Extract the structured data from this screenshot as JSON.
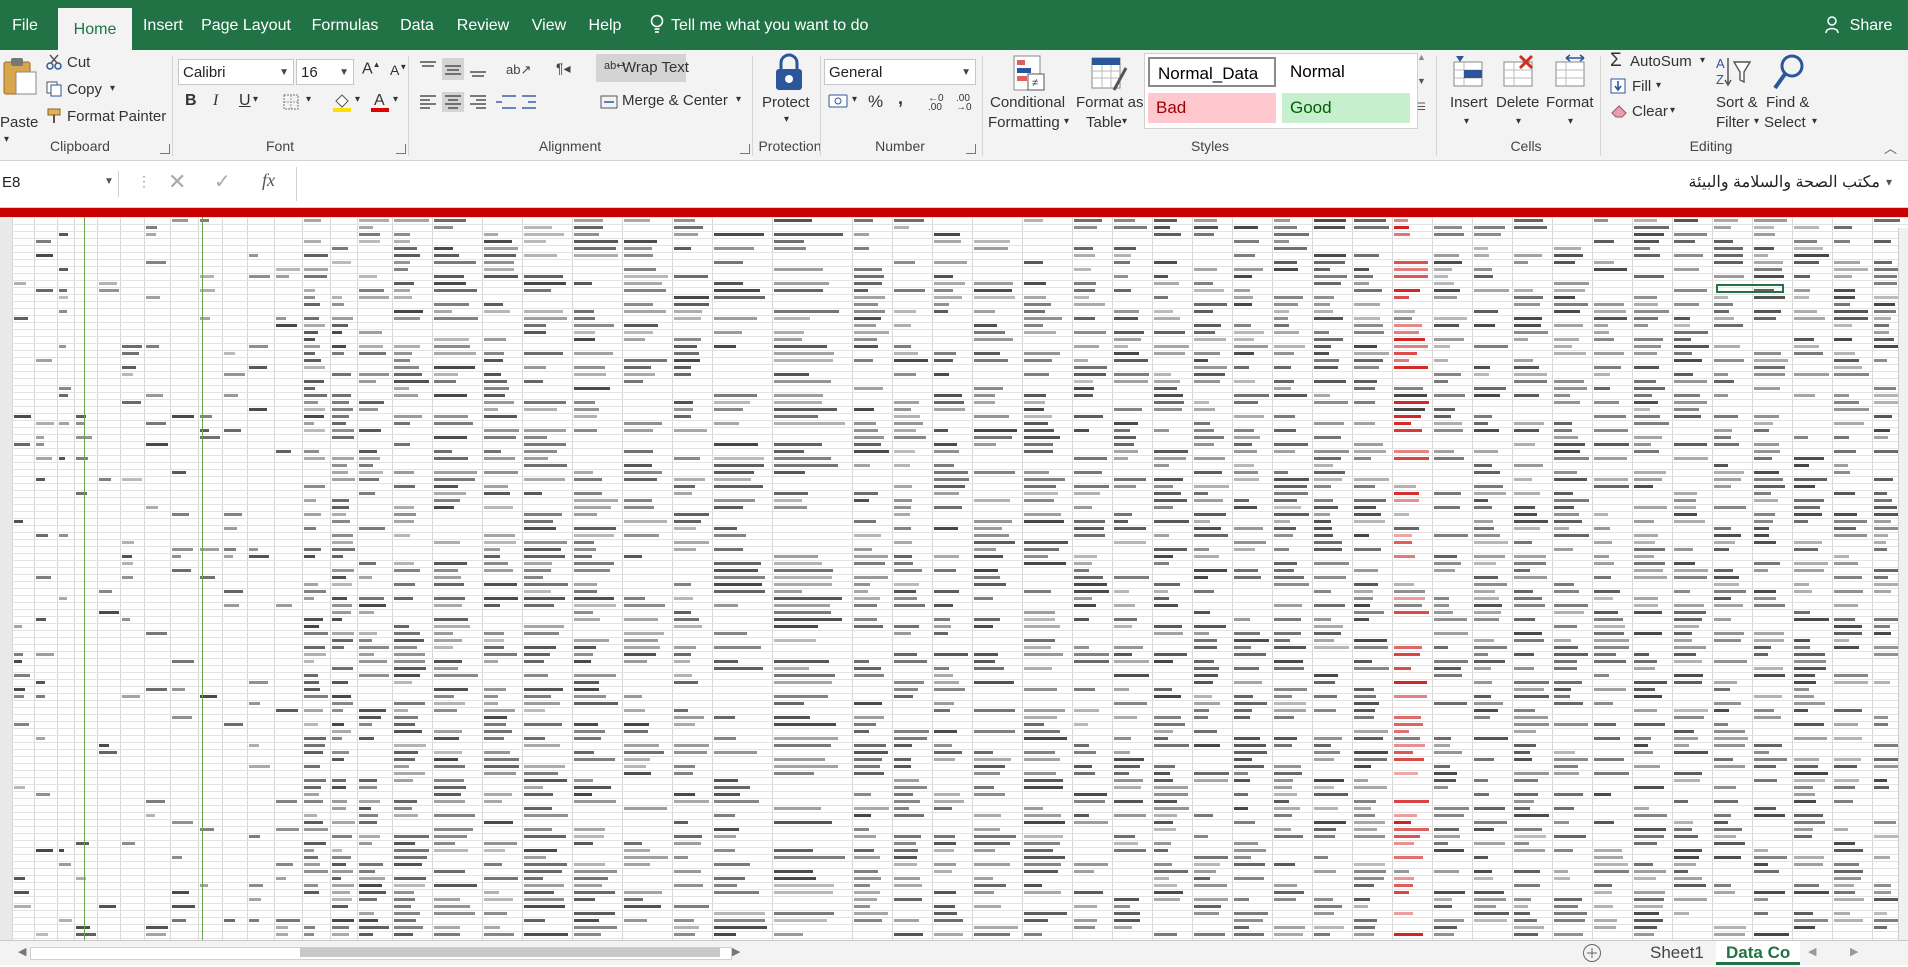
{
  "tabs": {
    "file": "File",
    "home": "Home",
    "insert": "Insert",
    "page_layout": "Page Layout",
    "formulas": "Formulas",
    "data": "Data",
    "review": "Review",
    "view": "View",
    "help": "Help",
    "tell_me": "Tell me what you want to do",
    "share": "Share"
  },
  "clipboard": {
    "paste": "Paste",
    "cut": "Cut",
    "copy": "Copy",
    "format_painter": "Format Painter",
    "label": "Clipboard"
  },
  "font": {
    "name": "Calibri",
    "size": "16",
    "bold": "B",
    "italic": "I",
    "underline": "U",
    "label": "Font"
  },
  "alignment": {
    "wrap_text": "Wrap Text",
    "merge_center": "Merge & Center",
    "label": "Alignment"
  },
  "protection": {
    "protect": "Protect",
    "label": "Protection"
  },
  "number": {
    "format": "General",
    "percent": "%",
    "comma": ",",
    "label": "Number"
  },
  "styles": {
    "conditional_formatting_1": "Conditional",
    "conditional_formatting_2": "Formatting",
    "format_as_table_1": "Format as",
    "format_as_table_2": "Table",
    "normal_data": "Normal_Data",
    "normal": "Normal",
    "bad": "Bad",
    "good": "Good",
    "label": "Styles"
  },
  "cells": {
    "insert": "Insert",
    "delete": "Delete",
    "format": "Format",
    "label": "Cells"
  },
  "editing": {
    "autosum": "AutoSum",
    "fill": "Fill",
    "clear": "Clear",
    "sort_filter_1": "Sort &",
    "sort_filter_2": "Filter",
    "find_select_1": "Find &",
    "find_select_2": "Select",
    "label": "Editing"
  },
  "formula_bar": {
    "name_box": "E8",
    "fx": "fx",
    "content": "مكتب الصحة والسلامة والبيئة"
  },
  "sheets": {
    "sheet1": "Sheet1",
    "data_co": "Data Co"
  },
  "colors": {
    "excel_green": "#217346",
    "header_red": "#c80000",
    "bad_fill": "#ffc7ce",
    "bad_text": "#9c0006",
    "good_fill": "#c6efce",
    "good_text": "#006100"
  }
}
